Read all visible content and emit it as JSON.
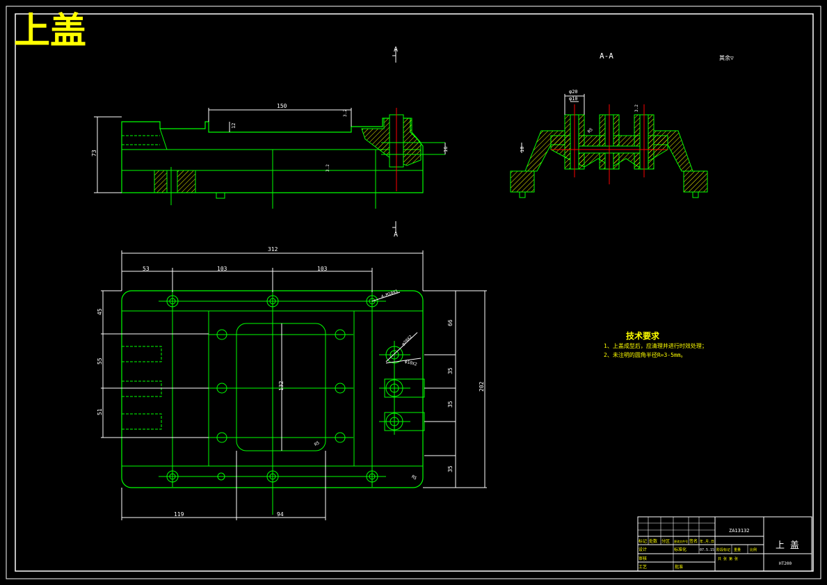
{
  "sheet": {
    "title": "上盖",
    "colors": {
      "background": "#000000",
      "outline": "#00ff00",
      "dimension": "#ffffff",
      "hatch": "#ffff00",
      "centerline": "#ff0000",
      "title": "#ffff00"
    }
  },
  "views": {
    "section_mark_top": "A",
    "section_mark_bottom": "A",
    "section_title": "A-A",
    "surface_note": "其余▽"
  },
  "front_view": {
    "dim_top_length": "150",
    "dim_height": "73",
    "dim_step": "12",
    "dim_right": "16",
    "roughness_1": "3.2",
    "roughness_2": "3.2"
  },
  "section_view": {
    "dim_bore_1": "φ20",
    "dim_bore_2": "φ10",
    "dim_side": "10",
    "dim_angle": "R5",
    "roughness": "3.2"
  },
  "plan_view": {
    "dim_total_width": "312",
    "dim_left_offset": "53",
    "dim_span_1": "103",
    "dim_span_2": "103",
    "dim_hole_note": "4-M10X1",
    "dim_inner_height": "132",
    "dim_left_1": "45",
    "dim_left_2": "55",
    "dim_left_3": "51",
    "dim_right_1": "66",
    "dim_right_2": "35",
    "dim_right_3": "35",
    "dim_right_4": "35",
    "dim_total_height": "202",
    "dim_bottom_1": "119",
    "dim_bottom_2": "94",
    "dim_callout_1": "φ20X2",
    "dim_callout_2": "φ10X2",
    "dim_r_1": "R5",
    "dim_r_2": "R5"
  },
  "tech_requirements": {
    "heading": "技术要求",
    "line_1": "1、上盖成型后，应清理并进行时效处理；",
    "line_2": "2、未注明的圆角半径R=3-5mm。"
  },
  "title_block": {
    "drawing_no": "ZA13132",
    "part_name": "上 盖",
    "material": "HT200",
    "r1_c1": "标记",
    "r1_c2": "处数",
    "r1_c3": "分区",
    "r1_c4": "更改文件号",
    "r1_c5": "签名",
    "r1_c6": "年.月.日",
    "r2_c1": "设计",
    "r2_c2": "标准化",
    "r2_c3": "07.5.15",
    "r2_c4": "阶段标记",
    "r2_c5": "重量",
    "r2_c6": "比例",
    "r3_c1": "审核",
    "r4_c1": "工艺",
    "r4_c2": "批准",
    "r4_c3": "共 张 第 张"
  }
}
